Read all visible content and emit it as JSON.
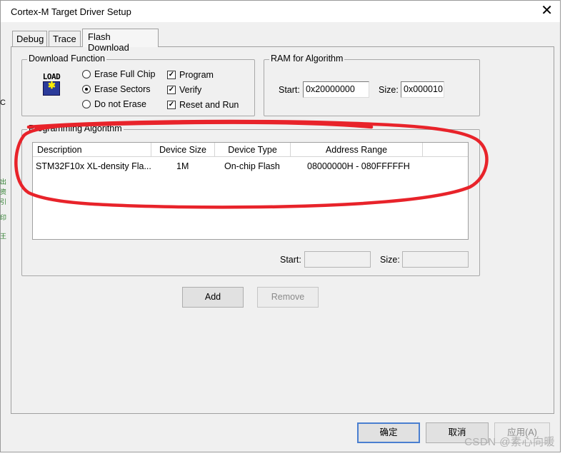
{
  "window": {
    "title": "Cortex-M Target Driver Setup",
    "close_glyph": "✕"
  },
  "left_strip": [
    "C",
    "出",
    "资",
    "引",
    "印",
    "王"
  ],
  "tabs": [
    {
      "label": "Debug"
    },
    {
      "label": "Trace"
    },
    {
      "label": "Flash Download",
      "active": true
    }
  ],
  "download_function": {
    "title": "Download Function",
    "icon": "load-icon",
    "icon_text": "LOAD",
    "erase_options": [
      {
        "label": "Erase Full Chip",
        "selected": false
      },
      {
        "label": "Erase Sectors",
        "selected": true
      },
      {
        "label": "Do not Erase",
        "selected": false
      }
    ],
    "checks": [
      {
        "label": "Program",
        "checked": true
      },
      {
        "label": "Verify",
        "checked": true
      },
      {
        "label": "Reset and Run",
        "checked": true
      }
    ]
  },
  "ram_for_algorithm": {
    "title": "RAM for Algorithm",
    "start_label": "Start:",
    "start_value": "0x20000000",
    "size_label": "Size:",
    "size_value": "0x000010"
  },
  "programming_algorithm": {
    "title": "Programming Algorithm",
    "columns": [
      "Description",
      "Device Size",
      "Device Type",
      "Address Range"
    ],
    "rows": [
      {
        "description": "STM32F10x XL-density Fla...",
        "device_size": "1M",
        "device_type": "On-chip Flash",
        "address_range": "08000000H - 080FFFFFH"
      }
    ],
    "start_label": "Start:",
    "start_value": "",
    "size_label": "Size:",
    "size_value": ""
  },
  "buttons": {
    "add": "Add",
    "remove": "Remove"
  },
  "footer": {
    "ok": "确定",
    "cancel": "取消",
    "apply": "应用(A)"
  },
  "watermark": "CSDN @素心向暖",
  "colors": {
    "annotation": "#e8232a",
    "default_button_border": "#4a7fd0",
    "icon_blue": "#2b3b9a"
  }
}
